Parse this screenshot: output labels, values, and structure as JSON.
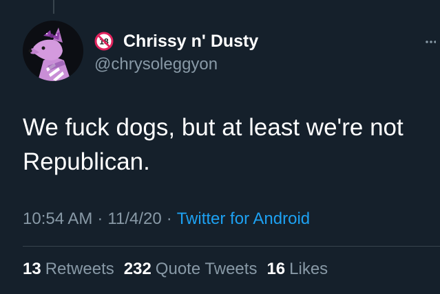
{
  "tweet": {
    "author": {
      "display_name": "Chrissy n' Dusty",
      "handle": "@chrysoleggyon",
      "badge_text": "18",
      "avatar_icon": "pink-dog-character-avatar"
    },
    "text": "We fuck dogs, but at least we're not Republican.",
    "time": "10:54 AM",
    "date": "11/4/20",
    "separator": "·",
    "source": "Twitter for Android",
    "stats": {
      "retweets_count": "13",
      "retweets_label": "Retweets",
      "quotes_count": "232",
      "quotes_label": "Quote Tweets",
      "likes_count": "16",
      "likes_label": "Likes"
    }
  },
  "colors": {
    "background": "#15202b",
    "text_primary": "#ffffff",
    "text_secondary": "#8899a6",
    "link": "#1da1f2",
    "divider": "#38444d",
    "badge_red": "#e0245e"
  }
}
